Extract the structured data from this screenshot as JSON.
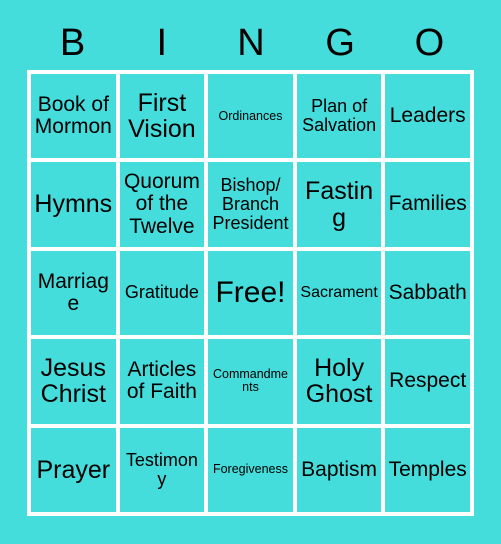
{
  "card": {
    "title_letters": [
      "B",
      "I",
      "N",
      "G",
      "O"
    ],
    "background_color": "#45dcdc",
    "grid_line_color": "#ffffff",
    "text_color": "#000000",
    "free_space": {
      "row": 3,
      "column": 3,
      "label": "Free!"
    },
    "rows": [
      [
        {
          "label": "Book of\nMormon",
          "size": "lg"
        },
        {
          "label": "First\nVision",
          "size": "xl"
        },
        {
          "label": "Ordinances",
          "size": "xs"
        },
        {
          "label": "Plan of\nSalvation",
          "size": "md"
        },
        {
          "label": "Leaders",
          "size": "lg"
        }
      ],
      [
        {
          "label": "Hymns",
          "size": "xl"
        },
        {
          "label": "Quorum\nof the\nTwelve",
          "size": "lg"
        },
        {
          "label": "Bishop/\nBranch\nPresident",
          "size": "md"
        },
        {
          "label": "Fasting",
          "size": "xl"
        },
        {
          "label": "Families",
          "size": "lg"
        }
      ],
      [
        {
          "label": "Marriage",
          "size": "lg"
        },
        {
          "label": "Gratitude",
          "size": "md"
        },
        {
          "label": "Free!",
          "size": "xxl"
        },
        {
          "label": "Sacrament",
          "size": "sm"
        },
        {
          "label": "Sabbath",
          "size": "lg"
        }
      ],
      [
        {
          "label": "Jesus\nChrist",
          "size": "xl"
        },
        {
          "label": "Articles\nof Faith",
          "size": "lg"
        },
        {
          "label": "Commandments",
          "size": "xs"
        },
        {
          "label": "Holy\nGhost",
          "size": "xl"
        },
        {
          "label": "Respect",
          "size": "lg"
        }
      ],
      [
        {
          "label": "Prayer",
          "size": "xl"
        },
        {
          "label": "Testimony",
          "size": "md"
        },
        {
          "label": "Foregiveness",
          "size": "xs"
        },
        {
          "label": "Baptism",
          "size": "lg"
        },
        {
          "label": "Temples",
          "size": "lg"
        }
      ]
    ]
  }
}
